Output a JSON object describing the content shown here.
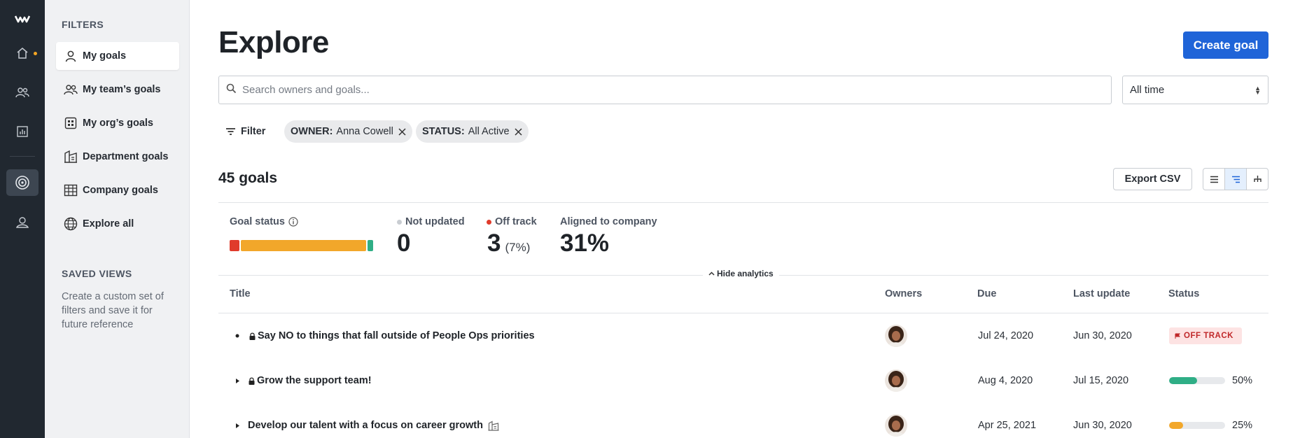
{
  "rail": {
    "items": [
      {
        "icon": "logo-icon"
      },
      {
        "icon": "home-icon"
      },
      {
        "icon": "people-icon"
      },
      {
        "icon": "analytics-icon"
      },
      {
        "icon": "goals-target-icon"
      },
      {
        "icon": "profile-icon"
      }
    ],
    "notification_color": "#f5a623"
  },
  "filters": {
    "heading": "FILTERS",
    "items": [
      {
        "label": "My goals",
        "icon": "person-icon",
        "active": true
      },
      {
        "label": "My team’s goals",
        "icon": "team-icon",
        "active": false
      },
      {
        "label": "My org’s goals",
        "icon": "org-icon",
        "active": false
      },
      {
        "label": "Department goals",
        "icon": "department-icon",
        "active": false
      },
      {
        "label": "Company goals",
        "icon": "company-icon",
        "active": false
      },
      {
        "label": "Explore all",
        "icon": "globe-icon",
        "active": false
      }
    ],
    "saved_views_heading": "SAVED VIEWS",
    "saved_views_text": "Create a custom set of filters and save it for future reference"
  },
  "header": {
    "title": "Explore",
    "create_button": "Create goal"
  },
  "search": {
    "placeholder": "Search owners and goals...",
    "value": ""
  },
  "time_filter": {
    "selected": "All time"
  },
  "filter_bar": {
    "filter_label": "Filter",
    "chips": [
      {
        "key": "OWNER:",
        "value": "Anna Cowell"
      },
      {
        "key": "STATUS:",
        "value": "All Active"
      }
    ]
  },
  "summary": {
    "count_label": "45 goals",
    "export_label": "Export CSV",
    "views": [
      "list-view-icon",
      "indented-view-icon",
      "tree-view-icon"
    ],
    "active_view": 1
  },
  "analytics": {
    "goal_status_label": "Goal status",
    "status_segments": [
      {
        "status": "off_track",
        "share": 0.07,
        "color": "#e03b2b"
      },
      {
        "status": "at_risk",
        "share": 0.89,
        "color": "#f2a72a"
      },
      {
        "status": "on_track",
        "share": 0.04,
        "color": "#2fae86"
      }
    ],
    "not_updated": {
      "label": "Not updated",
      "value": "0",
      "color": "#c9cdd2"
    },
    "off_track": {
      "label": "Off track",
      "value": "3",
      "sub": "(7%)",
      "color": "#e03b2b"
    },
    "aligned": {
      "label": "Aligned to company",
      "value": "31%"
    },
    "hide_label": "Hide analytics"
  },
  "table": {
    "columns": {
      "title": "Title",
      "owners": "Owners",
      "due": "Due",
      "last_update": "Last update",
      "status": "Status"
    },
    "rows": [
      {
        "title": "Say NO to things that fall outside of People Ops priorities",
        "private": true,
        "expandable": false,
        "due": "Jul 24, 2020",
        "last_update": "Jun 30, 2020",
        "status_type": "badge",
        "status_label": "OFF TRACK"
      },
      {
        "title": "Grow the support team!",
        "private": true,
        "expandable": true,
        "due": "Aug 4, 2020",
        "last_update": "Jul 15, 2020",
        "status_type": "progress",
        "progress": 0.5,
        "progress_label": "50%",
        "progress_color": "#2fae86"
      },
      {
        "title": "Develop our talent with a focus on career growth",
        "private": false,
        "expandable": true,
        "aligned_icon": "building-icon",
        "due": "Apr 25, 2021",
        "last_update": "Jun 30, 2020",
        "status_type": "progress",
        "progress": 0.25,
        "progress_label": "25%",
        "progress_color": "#f2a72a"
      }
    ]
  }
}
